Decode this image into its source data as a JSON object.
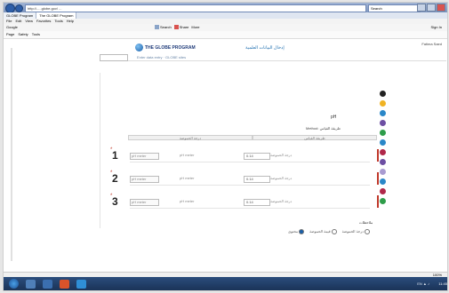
{
  "browser": {
    "address": "http://.....globe.gov/ ...",
    "search_placeholder": "Search",
    "tabs": [
      "GLOBE Program",
      "The GLOBE Program"
    ],
    "menu": [
      "File",
      "Edit",
      "View",
      "Favorites",
      "Tools",
      "Help"
    ],
    "google_label": "Google",
    "signin_label": "Sign In",
    "fav_items": [
      "Search",
      "Share",
      "More"
    ],
    "cmd_items": [
      "Page",
      "Safety",
      "Tools"
    ]
  },
  "page": {
    "logo_text": "THE GLOBE PROGRAM",
    "arabic_title": "إدخال البيانات العلمية",
    "user_link": "Fatima Saed",
    "subnav_links": "Enter data entry · GLOBE sites",
    "ph_label": "pH",
    "method_label": "Method: طريقة القياس",
    "header_cells": [
      "درجة الحموضة",
      "طريقة القياس"
    ],
    "rows": [
      {
        "num": "1",
        "unit": "pH meter",
        "inst": "pH meter",
        "val": "0.14",
        "ph": "درجة الحموضة"
      },
      {
        "num": "2",
        "unit": "pH meter",
        "inst": "pH meter",
        "val": "0.14",
        "ph": "درجة الحموضة"
      },
      {
        "num": "3",
        "unit": "pH meter",
        "inst": "pH meter",
        "val": "0.14",
        "ph": "درجة الحموضة"
      }
    ],
    "comment_label": "ملاحظات",
    "radio_a": "محتوى",
    "radio_b": "قيمة الحموضة",
    "radio_c": "درجة الحموضة"
  },
  "status": {
    "zoom": "100%"
  },
  "taskbar": {
    "clock": "11:45",
    "tray": "EN ▲ ♪"
  }
}
